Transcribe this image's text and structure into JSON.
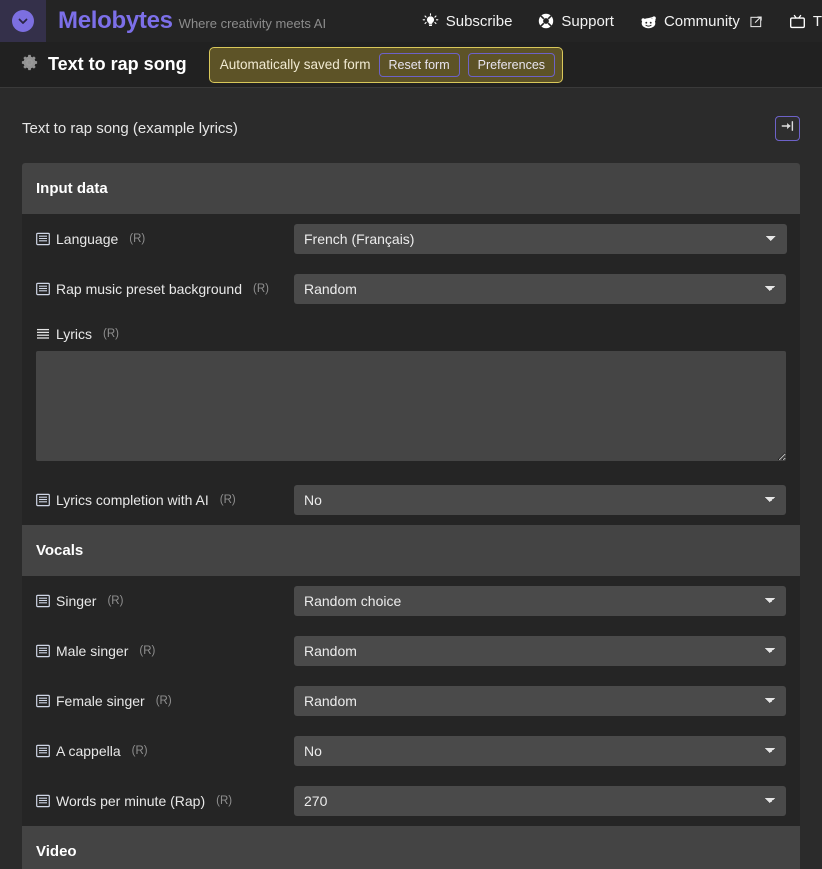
{
  "topnav": {
    "logo_icon": "chevron-down-circle-icon",
    "brand_name": "Melobytes",
    "brand_tagline": "Where creativity meets AI",
    "links": [
      {
        "label": "Subscribe",
        "icon": "lightbulb-icon",
        "external": false
      },
      {
        "label": "Support",
        "icon": "lifebuoy-icon",
        "external": false
      },
      {
        "label": "Community",
        "icon": "reddit-icon",
        "external": true
      },
      {
        "label": "T",
        "icon": "tv-icon",
        "external": false
      }
    ]
  },
  "subbar": {
    "icon": "gear-icon",
    "title": "Text to rap song",
    "notice": {
      "text": "Automatically saved form",
      "reset_label": "Reset form",
      "preferences_label": "Preferences"
    }
  },
  "page": {
    "title": "Text to rap song (example lyrics)",
    "collapse_icon": "arrow-to-right-icon"
  },
  "form": {
    "sections": [
      {
        "title": "Input data",
        "rows": [
          {
            "label": "Language",
            "required": "(R)",
            "icon": "list-box-icon",
            "type": "select",
            "value": "French (Français)"
          },
          {
            "label": "Rap music preset background",
            "required": "(R)",
            "icon": "list-box-icon",
            "type": "select",
            "value": "Random"
          },
          {
            "label": "Lyrics",
            "required": "(R)",
            "icon": "align-justify-icon",
            "type": "textarea",
            "value": "",
            "placeholder": ""
          },
          {
            "label": "Lyrics completion with AI",
            "required": "(R)",
            "icon": "list-box-icon",
            "type": "select",
            "value": "No"
          }
        ]
      },
      {
        "title": "Vocals",
        "rows": [
          {
            "label": "Singer",
            "required": "(R)",
            "icon": "list-box-icon",
            "type": "select",
            "value": "Random choice"
          },
          {
            "label": "Male singer",
            "required": "(R)",
            "icon": "list-box-icon",
            "type": "select",
            "value": "Random"
          },
          {
            "label": "Female singer",
            "required": "(R)",
            "icon": "list-box-icon",
            "type": "select",
            "value": "Random"
          },
          {
            "label": "A cappella",
            "required": "(R)",
            "icon": "list-box-icon",
            "type": "select",
            "value": "No"
          },
          {
            "label": "Words per minute (Rap)",
            "required": "(R)",
            "icon": "list-box-icon",
            "type": "select",
            "value": "270"
          }
        ]
      },
      {
        "title": "Video",
        "rows": []
      }
    ]
  },
  "colors": {
    "brand_purple": "#7c6fe8",
    "accent_border": "#6d62c8",
    "notice_bg": "#5d5327",
    "notice_border": "#d9c85a",
    "panel_bg": "#252525",
    "section_header_bg": "#444444",
    "field_bg": "#4a4a4a",
    "page_bg": "#2b2b2b"
  }
}
